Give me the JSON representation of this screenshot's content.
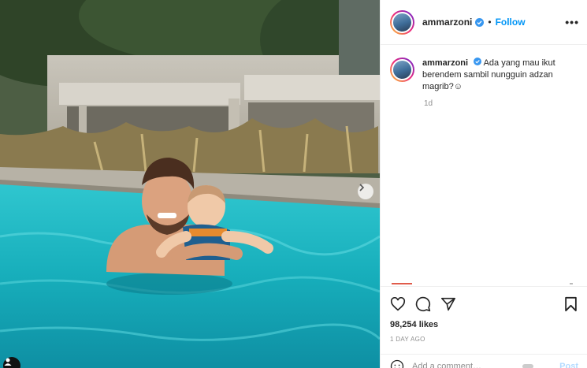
{
  "post": {
    "username": "ammarzoni",
    "follow_label": "Follow",
    "dot": "•",
    "more_label": "•••",
    "caption_user": "ammarzoni",
    "caption_text": "Ada yang mau ikut berendem sambil nungguin adzan magrib?☺",
    "time_ago": "1d",
    "likes": "98,254 likes",
    "posted": "1 DAY AGO"
  },
  "comment_box": {
    "placeholder": "Add a comment…",
    "post_label": "Post"
  },
  "colors": {
    "accent": "#0095f6",
    "pool": "#1fb8c4",
    "verified": "#3897f0"
  },
  "icons": {
    "like": "heart-icon",
    "comment": "comment-icon",
    "share": "share-icon",
    "save": "bookmark-icon",
    "emoji": "emoji-icon",
    "next": "chevron-right-icon",
    "tag": "user-tag-icon"
  }
}
